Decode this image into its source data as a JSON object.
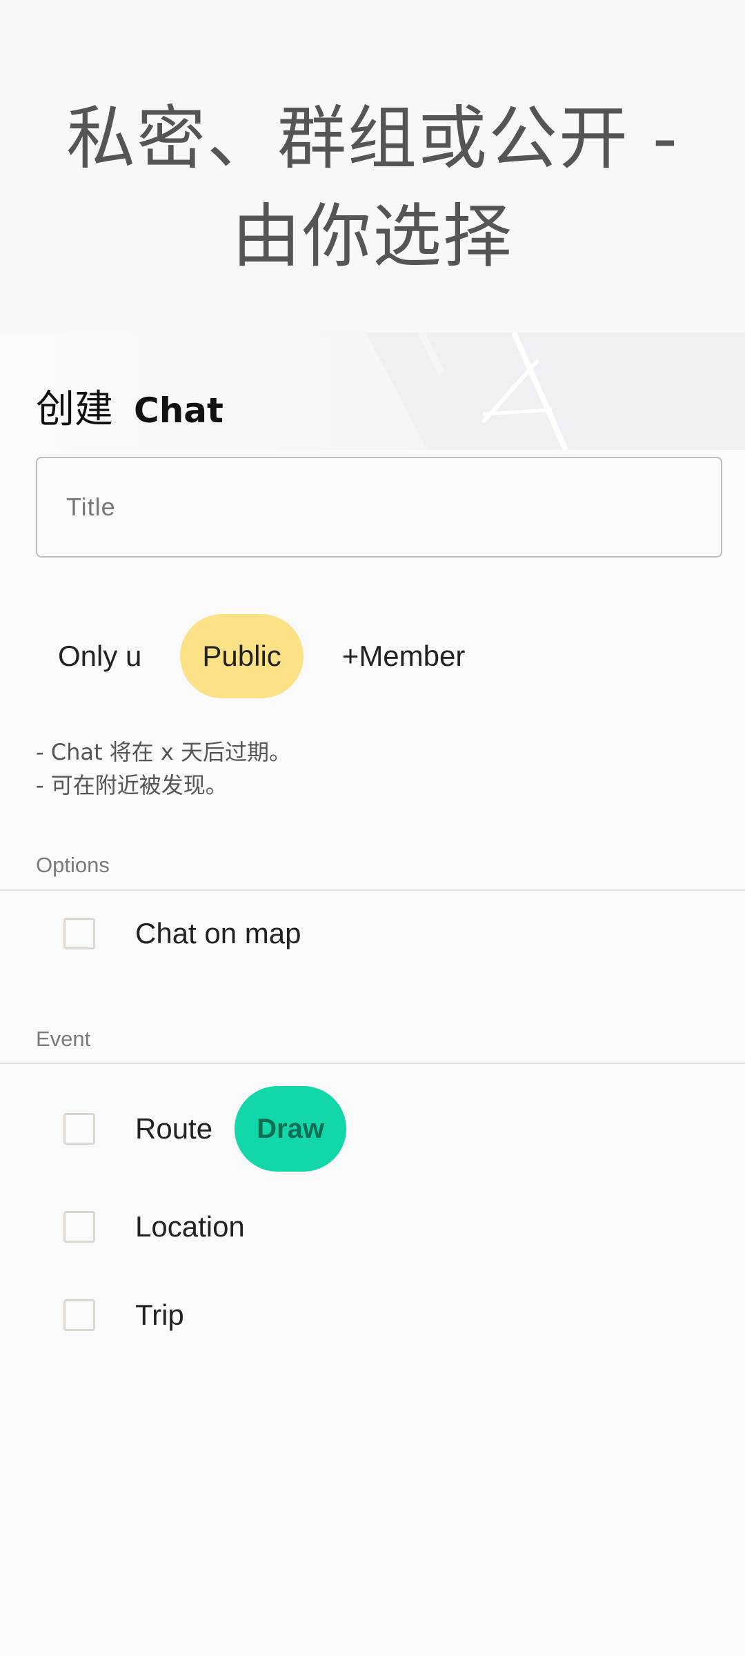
{
  "header": {
    "title_line1": "私密、群组或公开 -",
    "title_line2": "由你选择"
  },
  "form": {
    "section_title_cjk": "创建",
    "section_title_word": "Chat",
    "title_placeholder": "Title",
    "visibility_chips": [
      {
        "label": "Only u",
        "selected": false
      },
      {
        "label": "Public",
        "selected": true
      },
      {
        "label": "+Member",
        "selected": false
      }
    ],
    "info_lines": [
      "- Chat 将在 x 天后过期。",
      "- 可在附近被发现。"
    ]
  },
  "options": {
    "label": "Options",
    "items": [
      {
        "label": "Chat on map",
        "checked": false
      }
    ]
  },
  "event": {
    "label": "Event",
    "items": [
      {
        "label": "Route",
        "checked": false,
        "action_label": "Draw"
      },
      {
        "label": "Location",
        "checked": false
      },
      {
        "label": "Trip",
        "checked": false
      }
    ]
  },
  "colors": {
    "selected_chip": "#fde187",
    "draw_button": "#12d7a8",
    "draw_text": "#0e6e54"
  }
}
